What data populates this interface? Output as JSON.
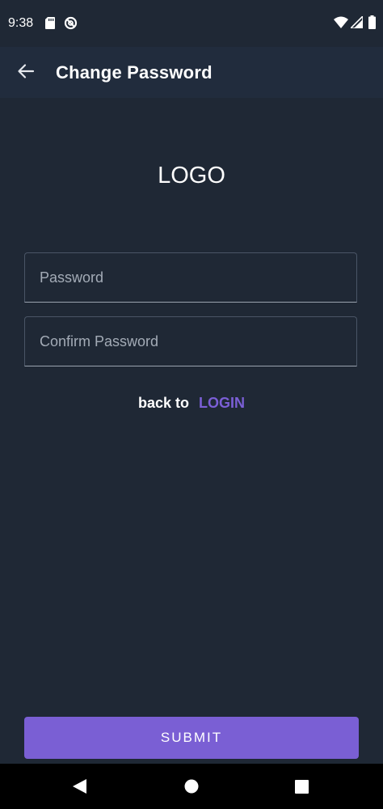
{
  "status_bar": {
    "time": "9:38",
    "icons": [
      "sd-card-icon",
      "sync-icon",
      "wifi-icon",
      "signal-icon",
      "battery-icon"
    ]
  },
  "app_bar": {
    "title": "Change Password",
    "back_icon": "arrow-left-icon"
  },
  "logo": {
    "text": "LOGO"
  },
  "form": {
    "password_placeholder": "Password",
    "confirm_placeholder": "Confirm Password",
    "password_value": "",
    "confirm_value": ""
  },
  "links": {
    "back_text": "back to",
    "login_label": "LOGIN"
  },
  "actions": {
    "submit_label": "SUBMIT"
  },
  "colors": {
    "background": "#1f2835",
    "app_bar": "#212c3d",
    "accent": "#7a5fd4",
    "text": "#ffffff",
    "placeholder": "#a3abb6"
  },
  "nav_bar": {
    "icons": [
      "nav-back-icon",
      "nav-home-icon",
      "nav-recents-icon"
    ]
  }
}
